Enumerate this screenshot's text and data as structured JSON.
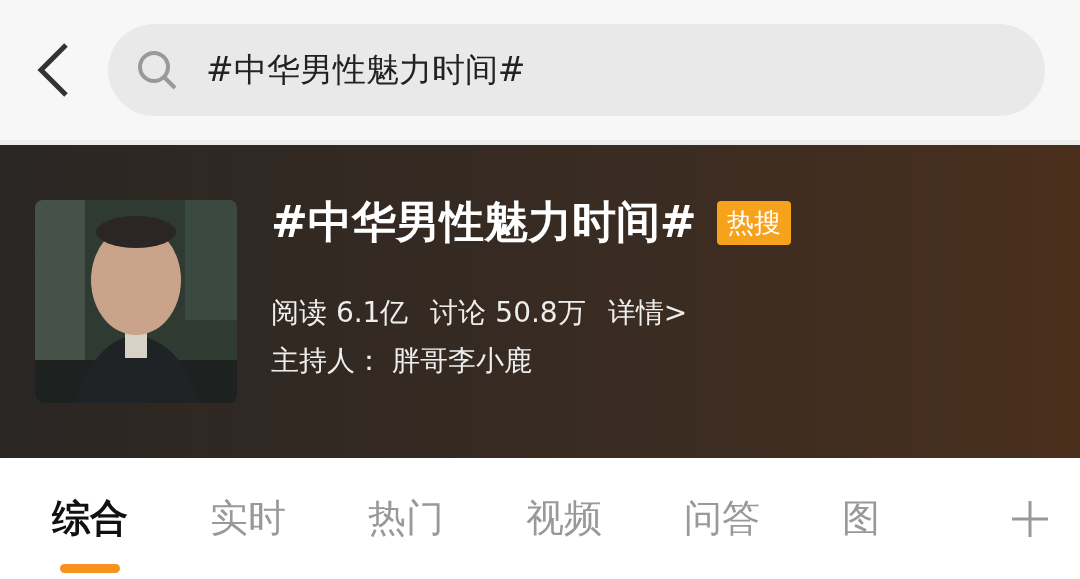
{
  "search": {
    "value": "#中华男性魅力时间#"
  },
  "topic": {
    "title": "#中华男性魅力时间#",
    "badge": "热搜",
    "stats": [
      "阅读 6.1亿",
      "讨论 50.8万",
      "详情>"
    ],
    "host": "主持人： 胖哥李小鹿"
  },
  "tabs": [
    {
      "label": "综合",
      "selected": true
    },
    {
      "label": "实时",
      "selected": false
    },
    {
      "label": "热门",
      "selected": false
    },
    {
      "label": "视频",
      "selected": false
    },
    {
      "label": "问答",
      "selected": false
    },
    {
      "label": "图",
      "selected": false
    }
  ]
}
